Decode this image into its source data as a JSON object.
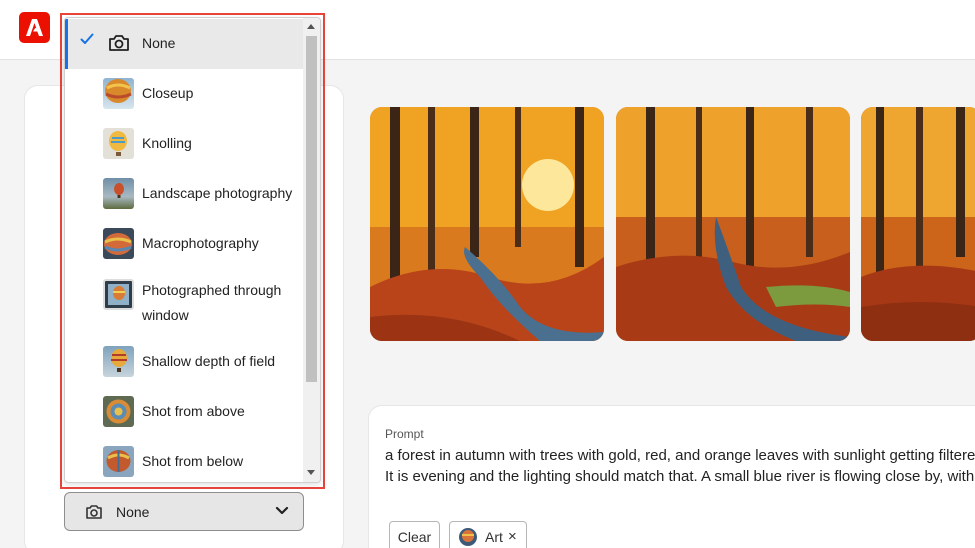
{
  "app": {
    "logo_icon": "adobe-firefly-logo-icon",
    "brand_color": "#eb1000"
  },
  "style_dropdown": {
    "selected_value": "None",
    "items": [
      {
        "label": "None",
        "icon": "camera-icon",
        "selected": true
      },
      {
        "label": "Closeup",
        "icon": "balloon-thumbnail"
      },
      {
        "label": "Knolling",
        "icon": "balloon-thumbnail"
      },
      {
        "label": "Landscape photography",
        "icon": "balloon-thumbnail"
      },
      {
        "label": "Macrophotography",
        "icon": "balloon-thumbnail"
      },
      {
        "label": "Photographed through",
        "label2": "window",
        "icon": "balloon-thumbnail"
      },
      {
        "label": "Shallow depth of field",
        "icon": "balloon-thumbnail"
      },
      {
        "label": "Shot from above",
        "icon": "balloon-thumbnail"
      },
      {
        "label": "Shot from below",
        "icon": "balloon-thumbnail"
      }
    ]
  },
  "gallery": {
    "images": [
      {
        "alt_icon": "autumn-forest-river-image"
      },
      {
        "alt_icon": "autumn-forest-river-image"
      },
      {
        "alt_icon": "autumn-forest-river-image"
      }
    ]
  },
  "prompt": {
    "title": "Prompt",
    "line1": "a forest in autumn with trees with gold, red, and orange leaves with sunlight getting filtered",
    "line2": "It is evening and the lighting should match that. A small blue river is flowing close by, with c",
    "clear_label": "Clear",
    "chip_label": "Art",
    "chip_remove": "×"
  }
}
